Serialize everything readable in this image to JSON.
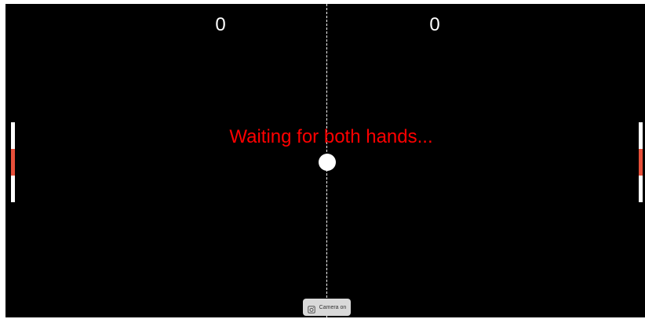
{
  "scoreboard": {
    "left_score": "0",
    "right_score": "0"
  },
  "status": {
    "message": "Waiting for both hands..."
  },
  "paddles": {
    "left": {
      "color": "#ffffff",
      "marker_color": "#e8503a",
      "marker_position": 0.5
    },
    "right": {
      "color": "#ffffff",
      "marker_color": "#e8503a",
      "marker_position": 0.5
    }
  },
  "ball": {
    "color": "#ffffff"
  },
  "camera_control": {
    "label": "Camera on",
    "icon": "camera-icon"
  },
  "colors": {
    "background": "#000000",
    "text": "#ffffff",
    "status": "#ff0000"
  }
}
